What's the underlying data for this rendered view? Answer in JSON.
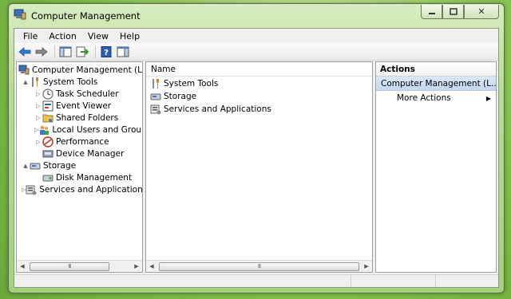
{
  "window": {
    "title": "Computer Management"
  },
  "caption": {
    "minimize": "▭",
    "maximize": "▢",
    "close": "✕"
  },
  "menu": [
    "File",
    "Action",
    "View",
    "Help"
  ],
  "toolbar": {
    "icons": [
      "back-arrow-icon",
      "forward-arrow-icon",
      "show-hide-console-tree-icon",
      "export-list-icon",
      "help-icon",
      "show-hide-action-pane-icon"
    ]
  },
  "tree": {
    "root": "Computer Management (Local",
    "items": [
      {
        "label": "System Tools",
        "level": 1,
        "expander": "▲",
        "icon": "system-tools-icon"
      },
      {
        "label": "Task Scheduler",
        "level": 2,
        "expander": "▷",
        "icon": "task-scheduler-icon"
      },
      {
        "label": "Event Viewer",
        "level": 2,
        "expander": "▷",
        "icon": "event-viewer-icon"
      },
      {
        "label": "Shared Folders",
        "level": 2,
        "expander": "▷",
        "icon": "shared-folders-icon"
      },
      {
        "label": "Local Users and Groups",
        "level": 2,
        "expander": "▷",
        "icon": "local-users-icon"
      },
      {
        "label": "Performance",
        "level": 2,
        "expander": "▷",
        "icon": "performance-icon"
      },
      {
        "label": "Device Manager",
        "level": 2,
        "expander": "",
        "icon": "device-manager-icon"
      },
      {
        "label": "Storage",
        "level": 1,
        "expander": "▲",
        "icon": "storage-icon"
      },
      {
        "label": "Disk Management",
        "level": 2,
        "expander": "",
        "icon": "disk-management-icon"
      },
      {
        "label": "Services and Applications",
        "level": 1,
        "expander": "▷",
        "icon": "services-icon"
      }
    ]
  },
  "list": {
    "column": "Name",
    "rows": [
      {
        "label": "System Tools",
        "icon": "system-tools-icon"
      },
      {
        "label": "Storage",
        "icon": "storage-icon"
      },
      {
        "label": "Services and Applications",
        "icon": "services-icon"
      }
    ]
  },
  "actions": {
    "header": "Actions",
    "section": "Computer Management (L...",
    "section_arrow": "▲",
    "items": [
      {
        "label": "More Actions",
        "arrow": "▶"
      }
    ]
  },
  "scrollbar": {
    "left_arrow": "◀",
    "right_arrow": "▶",
    "grip": "III"
  }
}
